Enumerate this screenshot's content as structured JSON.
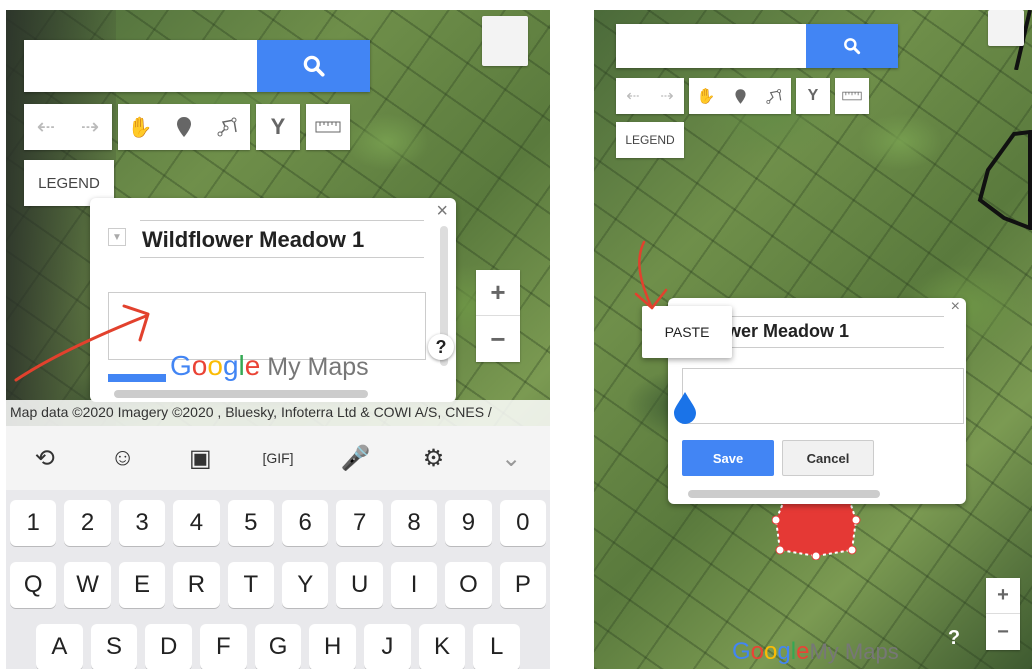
{
  "left": {
    "search": {
      "value": "",
      "placeholder": ""
    },
    "legend_label": "LEGEND",
    "card": {
      "title": "Wildflower Meadow 1",
      "description": "",
      "help": "?"
    },
    "logo": {
      "google": [
        "G",
        "o",
        "o",
        "g",
        "l",
        "e"
      ],
      "my_maps": "My Maps"
    },
    "attribution": "Map data ©2020 Imagery ©2020 , Bluesky, Infoterra Ltd & COWI A/S, CNES /",
    "zoom": {
      "plus": "+",
      "minus": "−"
    },
    "keyboard": {
      "row_numbers": [
        "1",
        "2",
        "3",
        "4",
        "5",
        "6",
        "7",
        "8",
        "9",
        "0"
      ],
      "row_top": [
        "Q",
        "W",
        "E",
        "R",
        "T",
        "Y",
        "U",
        "I",
        "O",
        "P"
      ],
      "row_mid": [
        "A",
        "S",
        "D",
        "F",
        "G",
        "H",
        "J",
        "K",
        "L"
      ]
    }
  },
  "right": {
    "search": {
      "value": "",
      "placeholder": ""
    },
    "legend_label": "LEGEND",
    "paste_label": "PASTE",
    "card": {
      "title": "ildflower Meadow 1",
      "description": "",
      "save_label": "Save",
      "cancel_label": "Cancel"
    },
    "logo": {
      "google": [
        "G",
        "o",
        "o",
        "g",
        "l",
        "e"
      ],
      "my_maps": "My Maps"
    },
    "zoom": {
      "plus": "+",
      "minus": "−"
    },
    "help": "?"
  },
  "colors": {
    "accent": "#4285f4",
    "annotation": "#e2412d",
    "marker": "#1a73e8",
    "polygon": "#e53935"
  }
}
